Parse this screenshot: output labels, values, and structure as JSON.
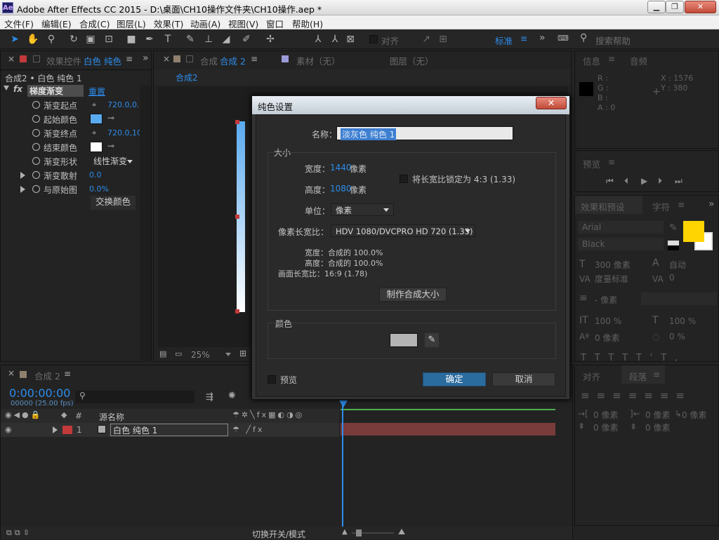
{
  "window": {
    "app_icon": "Ae",
    "title": "Adobe After Effects CC 2015 - D:\\桌面\\CH10操作文件夹\\CH10操作.aep *",
    "btn_minimize": "▁",
    "btn_restore": "❐",
    "btn_close": "✕"
  },
  "menu": [
    "文件(F)",
    "编辑(E)",
    "合成(C)",
    "图层(L)",
    "效果(T)",
    "动画(A)",
    "视图(V)",
    "窗口",
    "帮助(H)"
  ],
  "toolbar": {
    "align_label": "对齐",
    "workspace": "标准",
    "search_placeholder": "搜索帮助"
  },
  "effects_panel": {
    "tab_label": "效果控件",
    "tab_layer": "白色 纯色",
    "breadcrumb": "合成2 • 白色 纯色 1",
    "effect_name": "梯度渐变",
    "reset": "重置",
    "props": [
      {
        "label": "渐变起点",
        "value": "720.0,0.0"
      },
      {
        "label": "起始颜色",
        "value": ""
      },
      {
        "label": "渐变终点",
        "value": "720.0,10"
      },
      {
        "label": "结束颜色",
        "value": ""
      },
      {
        "label": "渐变形状",
        "value": "线性渐变"
      },
      {
        "label": "渐变散射",
        "value": "0.0"
      },
      {
        "label": "与原始图",
        "value": "0.0%"
      }
    ],
    "swap_button": "交换颜色",
    "start_color": "#5aaaf0",
    "end_color": "#ffffff"
  },
  "comp_panel": {
    "tab_comp": "合成",
    "tab_comp_name": "合成 2",
    "tab_footage": "素材（无）",
    "tab_layer": "图层（无）",
    "subtab": "合成2",
    "zoom": "25%"
  },
  "dialog": {
    "title": "纯色设置",
    "name_label": "名称：",
    "name_value": "淡灰色 纯色 1",
    "size_group": "大小",
    "width_label": "宽度：",
    "width_value": "1440",
    "width_unit": "像素",
    "height_label": "高度：",
    "height_value": "1080",
    "height_unit": "像素",
    "lock_label": "将长宽比锁定为 4:3 (1.33)",
    "units_label": "单位：",
    "units_value": "像素",
    "par_label": "像素长宽比：",
    "par_value": "HDV 1080/DVCPRO HD 720 (1.33)",
    "info_width": "宽度：合成的 100.0%",
    "info_height": "高度：合成的 100.0%",
    "info_aspect": "画面长宽比：16:9 (1.78)",
    "make_comp_size": "制作合成大小",
    "color_group": "颜色",
    "color_value": "#b4b4b4",
    "preview_label": "预览",
    "ok": "确定",
    "cancel": "取消"
  },
  "info_panel": {
    "tab": "信息",
    "tab_audio": "音频",
    "r": "R :",
    "g": "G :",
    "b": "B :",
    "a": "A : 0",
    "x": "X : 1576",
    "y": "Y : 380"
  },
  "preview_panel": {
    "tab": "预览"
  },
  "effects_presets": {
    "tab": "效果和预设",
    "tab_char": "字符"
  },
  "character_panel": {
    "font": "Arial",
    "style": "Black",
    "size": "300 像素",
    "leading": "自动",
    "kerning": "度量标准",
    "tracking": "0",
    "indent": "- 像素",
    "vscale": "100 %",
    "hscale": "100 %",
    "baseline": "0 像素",
    "tsume": "0 %",
    "fill_color": "#ffd400"
  },
  "paragraph_panel": {
    "tab_align": "对齐",
    "tab_para": "段落",
    "indent_left": "0 像素",
    "indent_right": "0 像素",
    "indent_first": "0 像素",
    "space_before": "0 像素",
    "space_after": "0 像素"
  },
  "timeline": {
    "tab": "合成 2",
    "timecode": "0:00:00:00",
    "fps": "00000 (25.00 fps)",
    "col_num": "#",
    "col_source": "源名称",
    "layer_num": "1",
    "layer_name": "白色 纯色 1",
    "layer_color": "#c23a3a",
    "footer": "切换开关/模式"
  }
}
